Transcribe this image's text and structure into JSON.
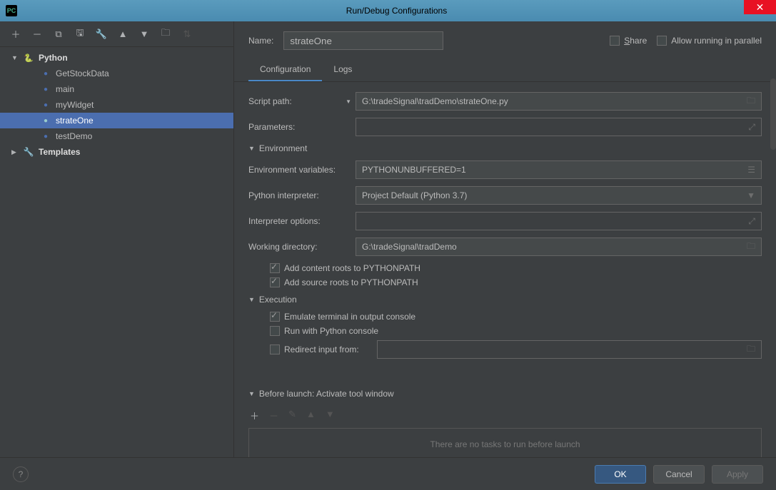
{
  "titlebar": {
    "title": "Run/Debug Configurations"
  },
  "tree": {
    "python_label": "Python",
    "items": [
      "GetStockData",
      "main",
      "myWidget",
      "strateOne",
      "testDemo"
    ],
    "templates_label": "Templates"
  },
  "name_row": {
    "label": "Name:",
    "value": "strateOne",
    "share": "Share",
    "allow_parallel": "Allow running in parallel"
  },
  "tabs": {
    "config": "Configuration",
    "logs": "Logs"
  },
  "form": {
    "script_path_label": "Script path:",
    "script_path": "G:\\tradeSignal\\tradDemo\\strateOne.py",
    "parameters_label": "Parameters:",
    "parameters": "",
    "env_header": "Environment",
    "env_vars_label": "Environment variables:",
    "env_vars": "PYTHONUNBUFFERED=1",
    "interpreter_label": "Python interpreter:",
    "interpreter": "Project Default (Python 3.7)",
    "interp_opts_label": "Interpreter options:",
    "interp_opts": "",
    "workdir_label": "Working directory:",
    "workdir": "G:\\tradeSignal\\tradDemo",
    "add_content_roots": "Add content roots to PYTHONPATH",
    "add_source_roots": "Add source roots to PYTHONPATH",
    "exec_header": "Execution",
    "emulate_terminal": "Emulate terminal in output console",
    "run_py_console": "Run with Python console",
    "redirect_input_label": "Redirect input from:",
    "redirect_input": "",
    "before_launch_header": "Before launch: Activate tool window",
    "no_tasks": "There are no tasks to run before launch"
  },
  "footer": {
    "ok": "OK",
    "cancel": "Cancel",
    "apply": "Apply"
  }
}
